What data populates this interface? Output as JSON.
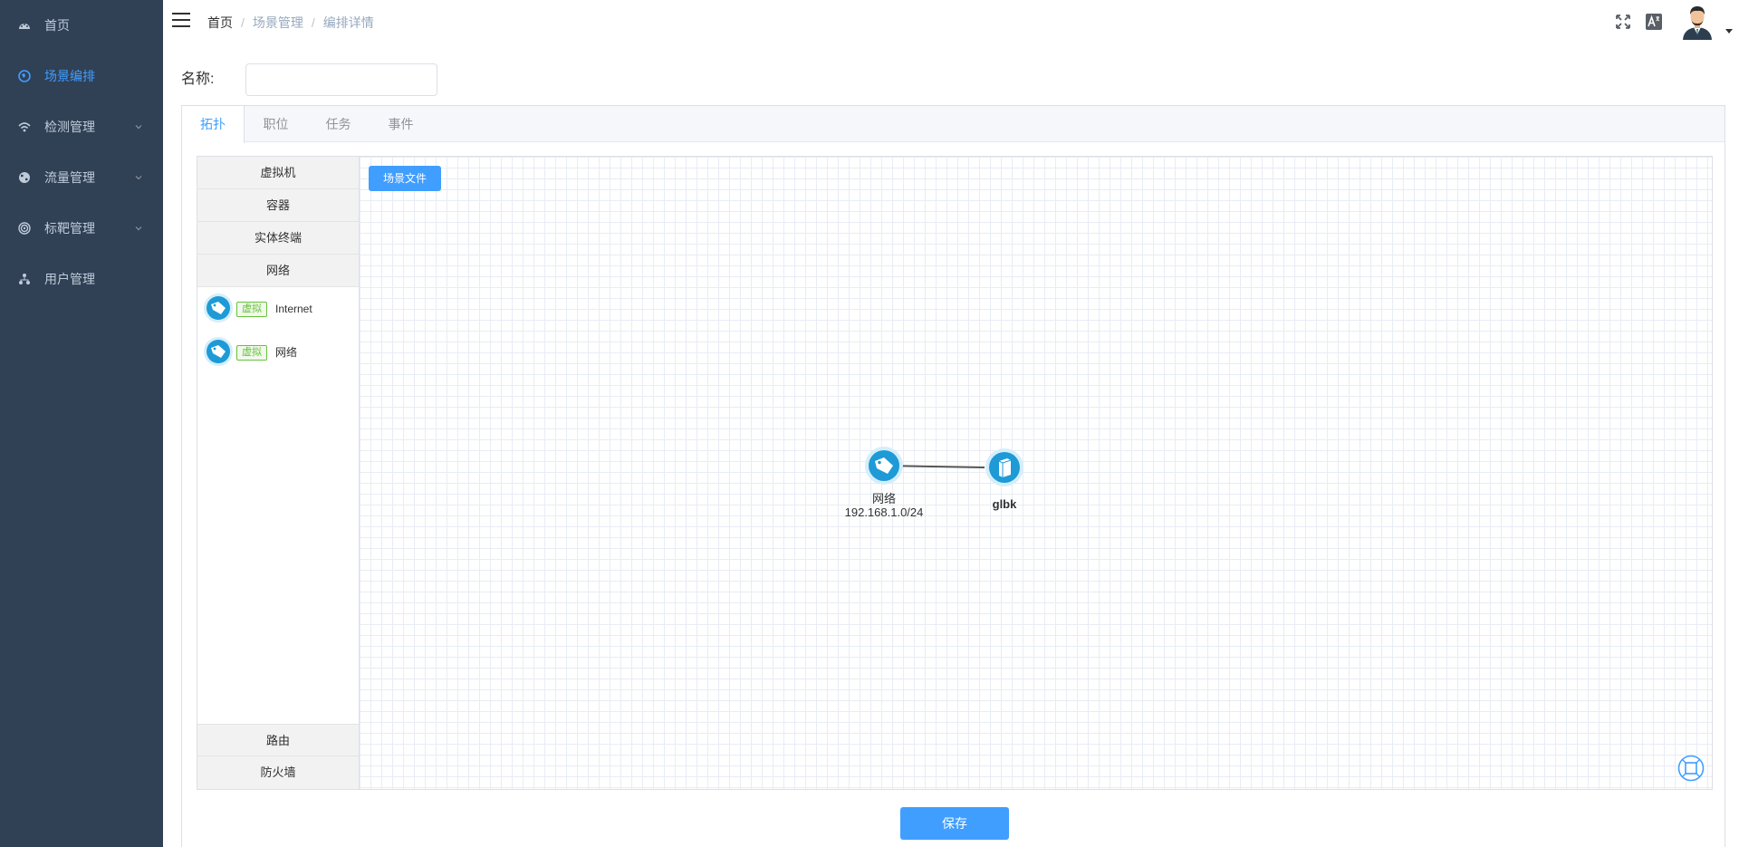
{
  "sidebar": {
    "items": [
      {
        "label": "首页",
        "icon": "dashboard-icon",
        "has_arrow": false,
        "active": false
      },
      {
        "label": "场景编排",
        "icon": "globe-icon",
        "has_arrow": false,
        "active": true
      },
      {
        "label": "检测管理",
        "icon": "wifi-icon",
        "has_arrow": true,
        "active": false
      },
      {
        "label": "流量管理",
        "icon": "earth-icon",
        "has_arrow": true,
        "active": false
      },
      {
        "label": "标靶管理",
        "icon": "target-icon",
        "has_arrow": true,
        "active": false
      },
      {
        "label": "用户管理",
        "icon": "users-tree-icon",
        "has_arrow": false,
        "active": false
      }
    ]
  },
  "header": {
    "breadcrumb": [
      "首页",
      "场景管理",
      "编排详情"
    ],
    "icons": [
      "fullscreen-icon",
      "translate-icon",
      "user-avatar"
    ]
  },
  "form": {
    "name_label": "名称:",
    "name_value": ""
  },
  "tabs": [
    {
      "label": "拓扑",
      "active": true
    },
    {
      "label": "职位",
      "active": false
    },
    {
      "label": "任务",
      "active": false
    },
    {
      "label": "事件",
      "active": false
    }
  ],
  "palette": {
    "sections_top": [
      "虚拟机",
      "容器",
      "实体终端",
      "网络"
    ],
    "network_items": [
      {
        "tag": "虚拟",
        "label": "Internet"
      },
      {
        "tag": "虚拟",
        "label": "网络"
      }
    ],
    "sections_bottom": [
      "路由",
      "防火墙"
    ]
  },
  "canvas": {
    "scene_button": "场景文件",
    "nodes": [
      {
        "name": "网络",
        "subtitle": "192.168.1.0/24",
        "icon": "network-tag-icon"
      },
      {
        "name": "glbk",
        "subtitle": "",
        "icon": "server-icon"
      }
    ]
  },
  "actions": {
    "save": "保存"
  },
  "colors": {
    "sidebar_bg": "#304156",
    "sidebar_text": "#bfcbd9",
    "accent": "#409eff",
    "tag_green": "#67c23a"
  }
}
